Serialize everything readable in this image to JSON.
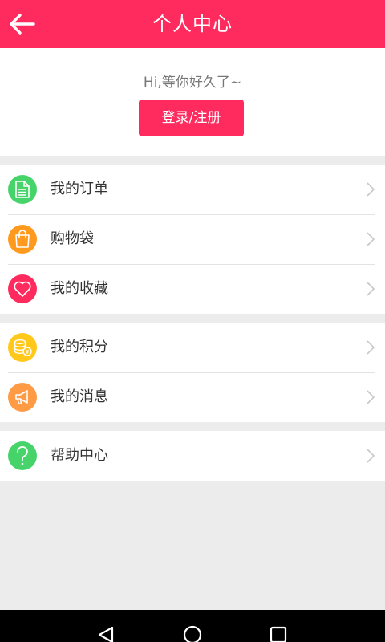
{
  "header": {
    "title": "个人中心",
    "back_icon": "arrow-left-icon"
  },
  "login": {
    "greeting": "Hi,等你好久了~",
    "button_label": "登录/注册"
  },
  "menu": {
    "group1": [
      {
        "label": "我的订单",
        "icon": "order-document-icon",
        "color": "#46d36a"
      },
      {
        "label": "购物袋",
        "icon": "shopping-bag-icon",
        "color": "#ff9a1f"
      },
      {
        "label": "我的收藏",
        "icon": "heart-icon",
        "color": "#ff2b5e"
      }
    ],
    "group2": [
      {
        "label": "我的积分",
        "icon": "coins-icon",
        "color": "#ffc81a"
      },
      {
        "label": "我的消息",
        "icon": "megaphone-icon",
        "color": "#ff9a45"
      }
    ],
    "group3": [
      {
        "label": "帮助中心",
        "icon": "question-icon",
        "color": "#46d36a"
      }
    ]
  },
  "theme": {
    "accent": "#ff2b5e",
    "background": "#ececec"
  }
}
